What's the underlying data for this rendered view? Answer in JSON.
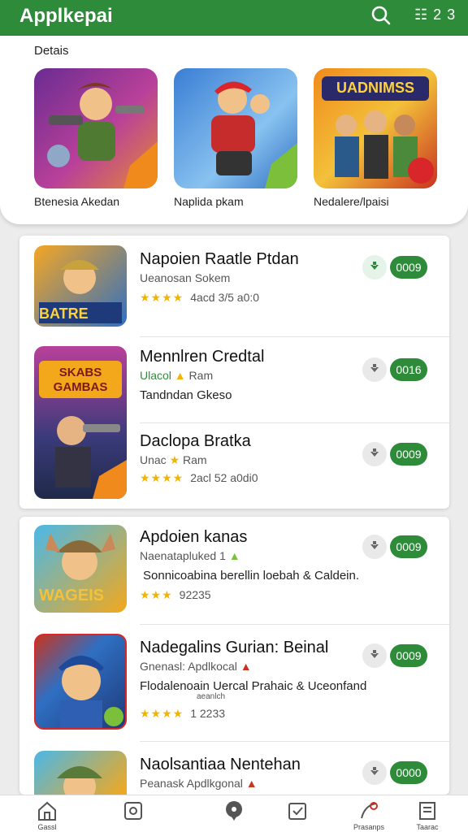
{
  "header": {
    "title": "Applkepai",
    "menu_badge": "2 3"
  },
  "featured": {
    "title": "Detais",
    "items": [
      {
        "label": "Btenesia Akedan"
      },
      {
        "label": "Naplida pkam"
      },
      {
        "label": "Nedalere/lpaisi"
      }
    ],
    "tile_text": "UADNIMSS"
  },
  "apps": [
    {
      "name": "Napoien Raatle Ptdan",
      "sub": "Ueanosan Sokem",
      "rating_text": "4acd 3/5 a0:0",
      "price": "0009",
      "thumb_text": "BATRE"
    },
    {
      "name": "Mennlren Credtal",
      "sub_accent": "Ulacol",
      "sub": "Ram",
      "desc": "Tandndan Gkeso",
      "price": "0016",
      "thumb_text": "SKABS GAMBAS"
    },
    {
      "name": "Daclopa Bratka",
      "sub": "Unac",
      "sub2": "Ram",
      "rating_text": "2acl 52 a0di0",
      "price": "0009"
    },
    {
      "name": "Apdoien kanas",
      "sub": "Naenatapluked 1",
      "desc": "Sonnicoabina berellin loebah & Caldein.",
      "rating_text": "92235",
      "price": "0009",
      "thumb_text": "WAGEIS"
    },
    {
      "name": "Nadegalins Gurian: Beinal",
      "sub": "Gnenasl: Apdlkocal",
      "desc": "Flodalenoain Uercal Prahaic & Uceonfand",
      "desc2": "aeanlch",
      "rating_text": "1 2233",
      "price": "0009"
    },
    {
      "name": "Naolsantiaa Nentehan",
      "sub": "Peanask Apdlkgonal",
      "price": "0000"
    }
  ],
  "nav": [
    {
      "label": "Gassl",
      "icon": "home-icon"
    },
    {
      "label": "",
      "icon": "games-icon"
    },
    {
      "label": "",
      "icon": "location-icon"
    },
    {
      "label": "",
      "icon": "updates-icon"
    },
    {
      "label": "Prasanps",
      "icon": "profile-icon"
    },
    {
      "label": "Taarac",
      "icon": "library-icon"
    }
  ],
  "colors": {
    "brand": "#2e8b3a",
    "star": "#f2b400"
  }
}
